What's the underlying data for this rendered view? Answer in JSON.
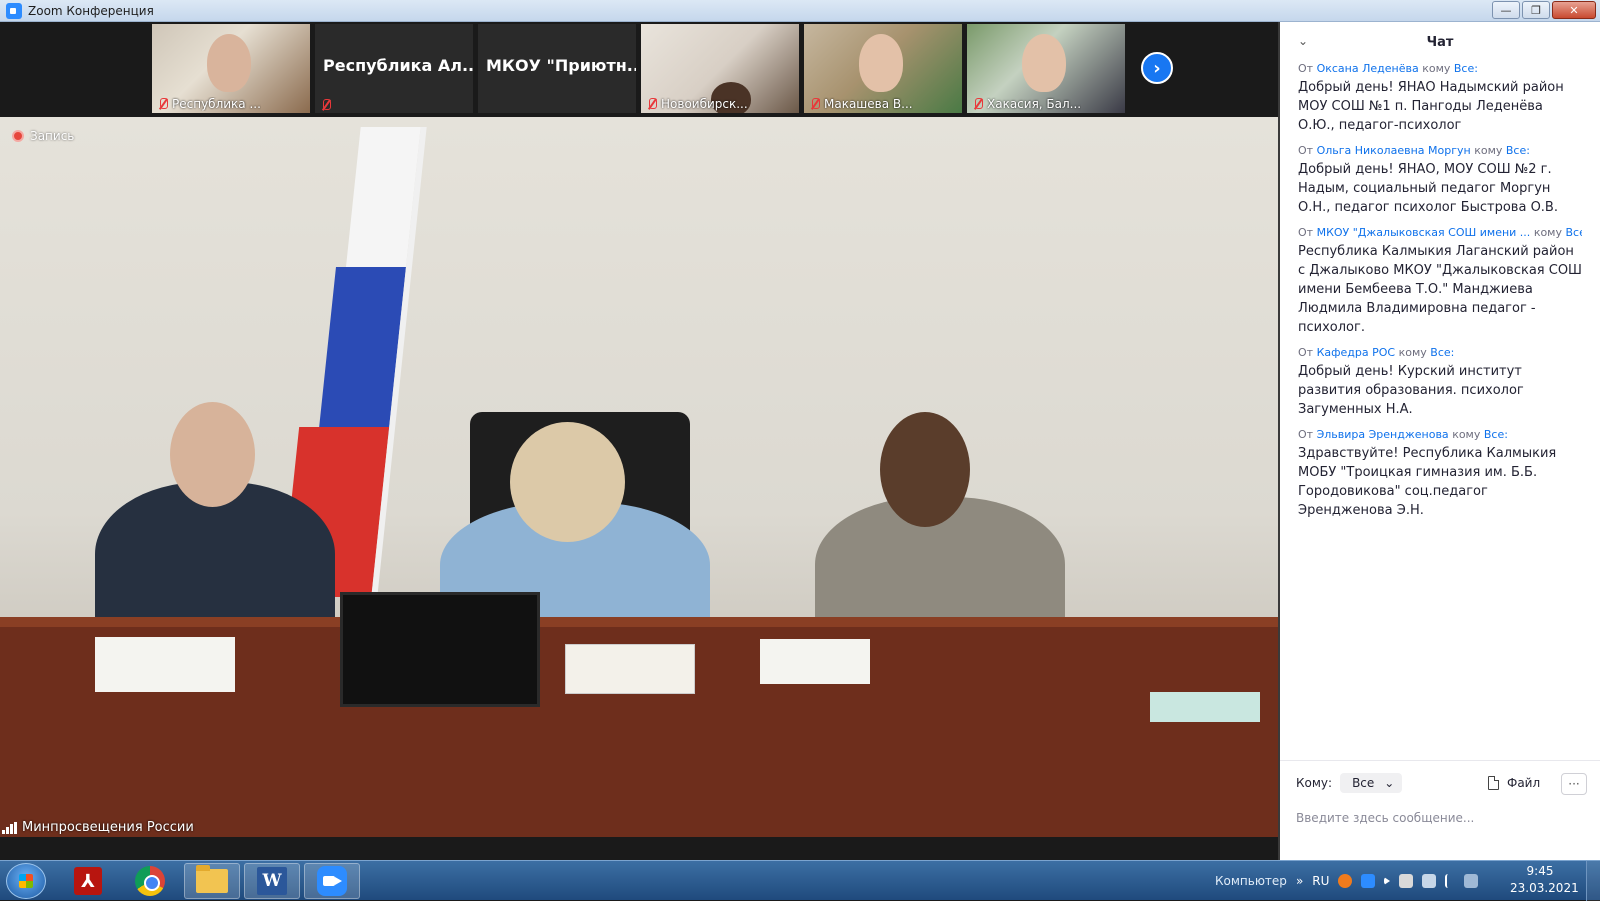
{
  "window": {
    "title": "Zoom Конференция",
    "minimize": "—",
    "maximize": "❐",
    "close": "✕"
  },
  "participants": [
    {
      "name": "Республика ...",
      "muted": true,
      "video": true
    },
    {
      "name": "",
      "center_name": "Республика  Ал...",
      "muted": true,
      "video": false
    },
    {
      "name": "",
      "center_name": "МКОУ  \"Приютн...",
      "muted": false,
      "video": false
    },
    {
      "name": "Новоибирск...",
      "muted": true,
      "video": true
    },
    {
      "name": "Макашева В...",
      "muted": true,
      "video": true
    },
    {
      "name": "Хакасия, Бал...",
      "muted": true,
      "video": true
    }
  ],
  "next_button": "›",
  "main_video": {
    "recording_label": "Запись",
    "speaker_name": "Минпросвещения России"
  },
  "chat": {
    "title": "Чат",
    "collapse_glyph": "⌄",
    "messages": [
      {
        "from_label": "От",
        "sender": "Оксана Леденёва",
        "to_label": "кому",
        "to": "Все:",
        "text": "Добрый день! ЯНАО Надымский район МОУ СОШ №1 п. Пангоды Леденёва О.Ю., педагог-психолог"
      },
      {
        "from_label": "От",
        "sender": "Ольга Николаевна Моргун",
        "to_label": "кому",
        "to": "Все:",
        "text": "Добрый день! ЯНАО, МОУ СОШ №2 г. Надым, социальный педагог Моргун О.Н., педагог психолог Быстрова О.В."
      },
      {
        "from_label": "От",
        "sender": "МКОУ \"Джалыковская СОШ имени ...",
        "to_label": "кому",
        "to": "Все:",
        "text": "Республика Калмыкия Лаганский район с Джалыково МКОУ \"Джалыковская СОШ имени Бембеева Т.О.\" Манджиева Людмила Владимировна педагог - психолог."
      },
      {
        "from_label": "От",
        "sender": "Кафедра РОС",
        "to_label": "кому",
        "to": "Все:",
        "text": "Добрый день! Курский институт развития образования. психолог Загуменных Н.А."
      },
      {
        "from_label": "От",
        "sender": "Эльвира Эрендженова",
        "to_label": "кому",
        "to": "Все:",
        "text": "Здравствуйте! Республика Калмыкия МОБУ \"Троицкая гимназия им. Б.Б. Городовикова\" соц.педагог Эрендженова Э.Н."
      }
    ],
    "footer": {
      "to_label": "Кому:",
      "to_value": "Все",
      "file_label": "Файл",
      "more": "···",
      "placeholder": "Введите здесь сообщение..."
    }
  },
  "taskbar": {
    "tray_label": "Компьютер",
    "tray_chevron": "»",
    "language": "RU",
    "time": "9:45",
    "date": "23.03.2021"
  }
}
